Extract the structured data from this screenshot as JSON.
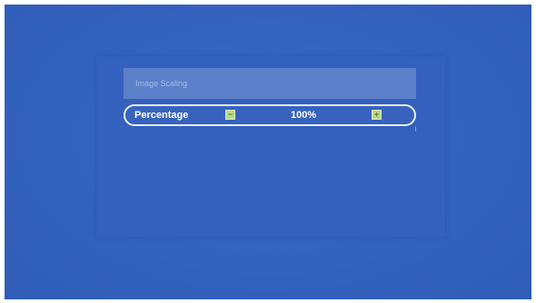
{
  "menu": {
    "title": "Image Scaling",
    "row": {
      "label": "Percentage",
      "value": "100%",
      "decrease_icon": "minus-icon",
      "increase_icon": "plus-icon"
    }
  },
  "colors": {
    "background": "#3463bf",
    "header": "#5c80ca",
    "highlight_border": "#e9eef8",
    "button": "#b8d88d"
  }
}
